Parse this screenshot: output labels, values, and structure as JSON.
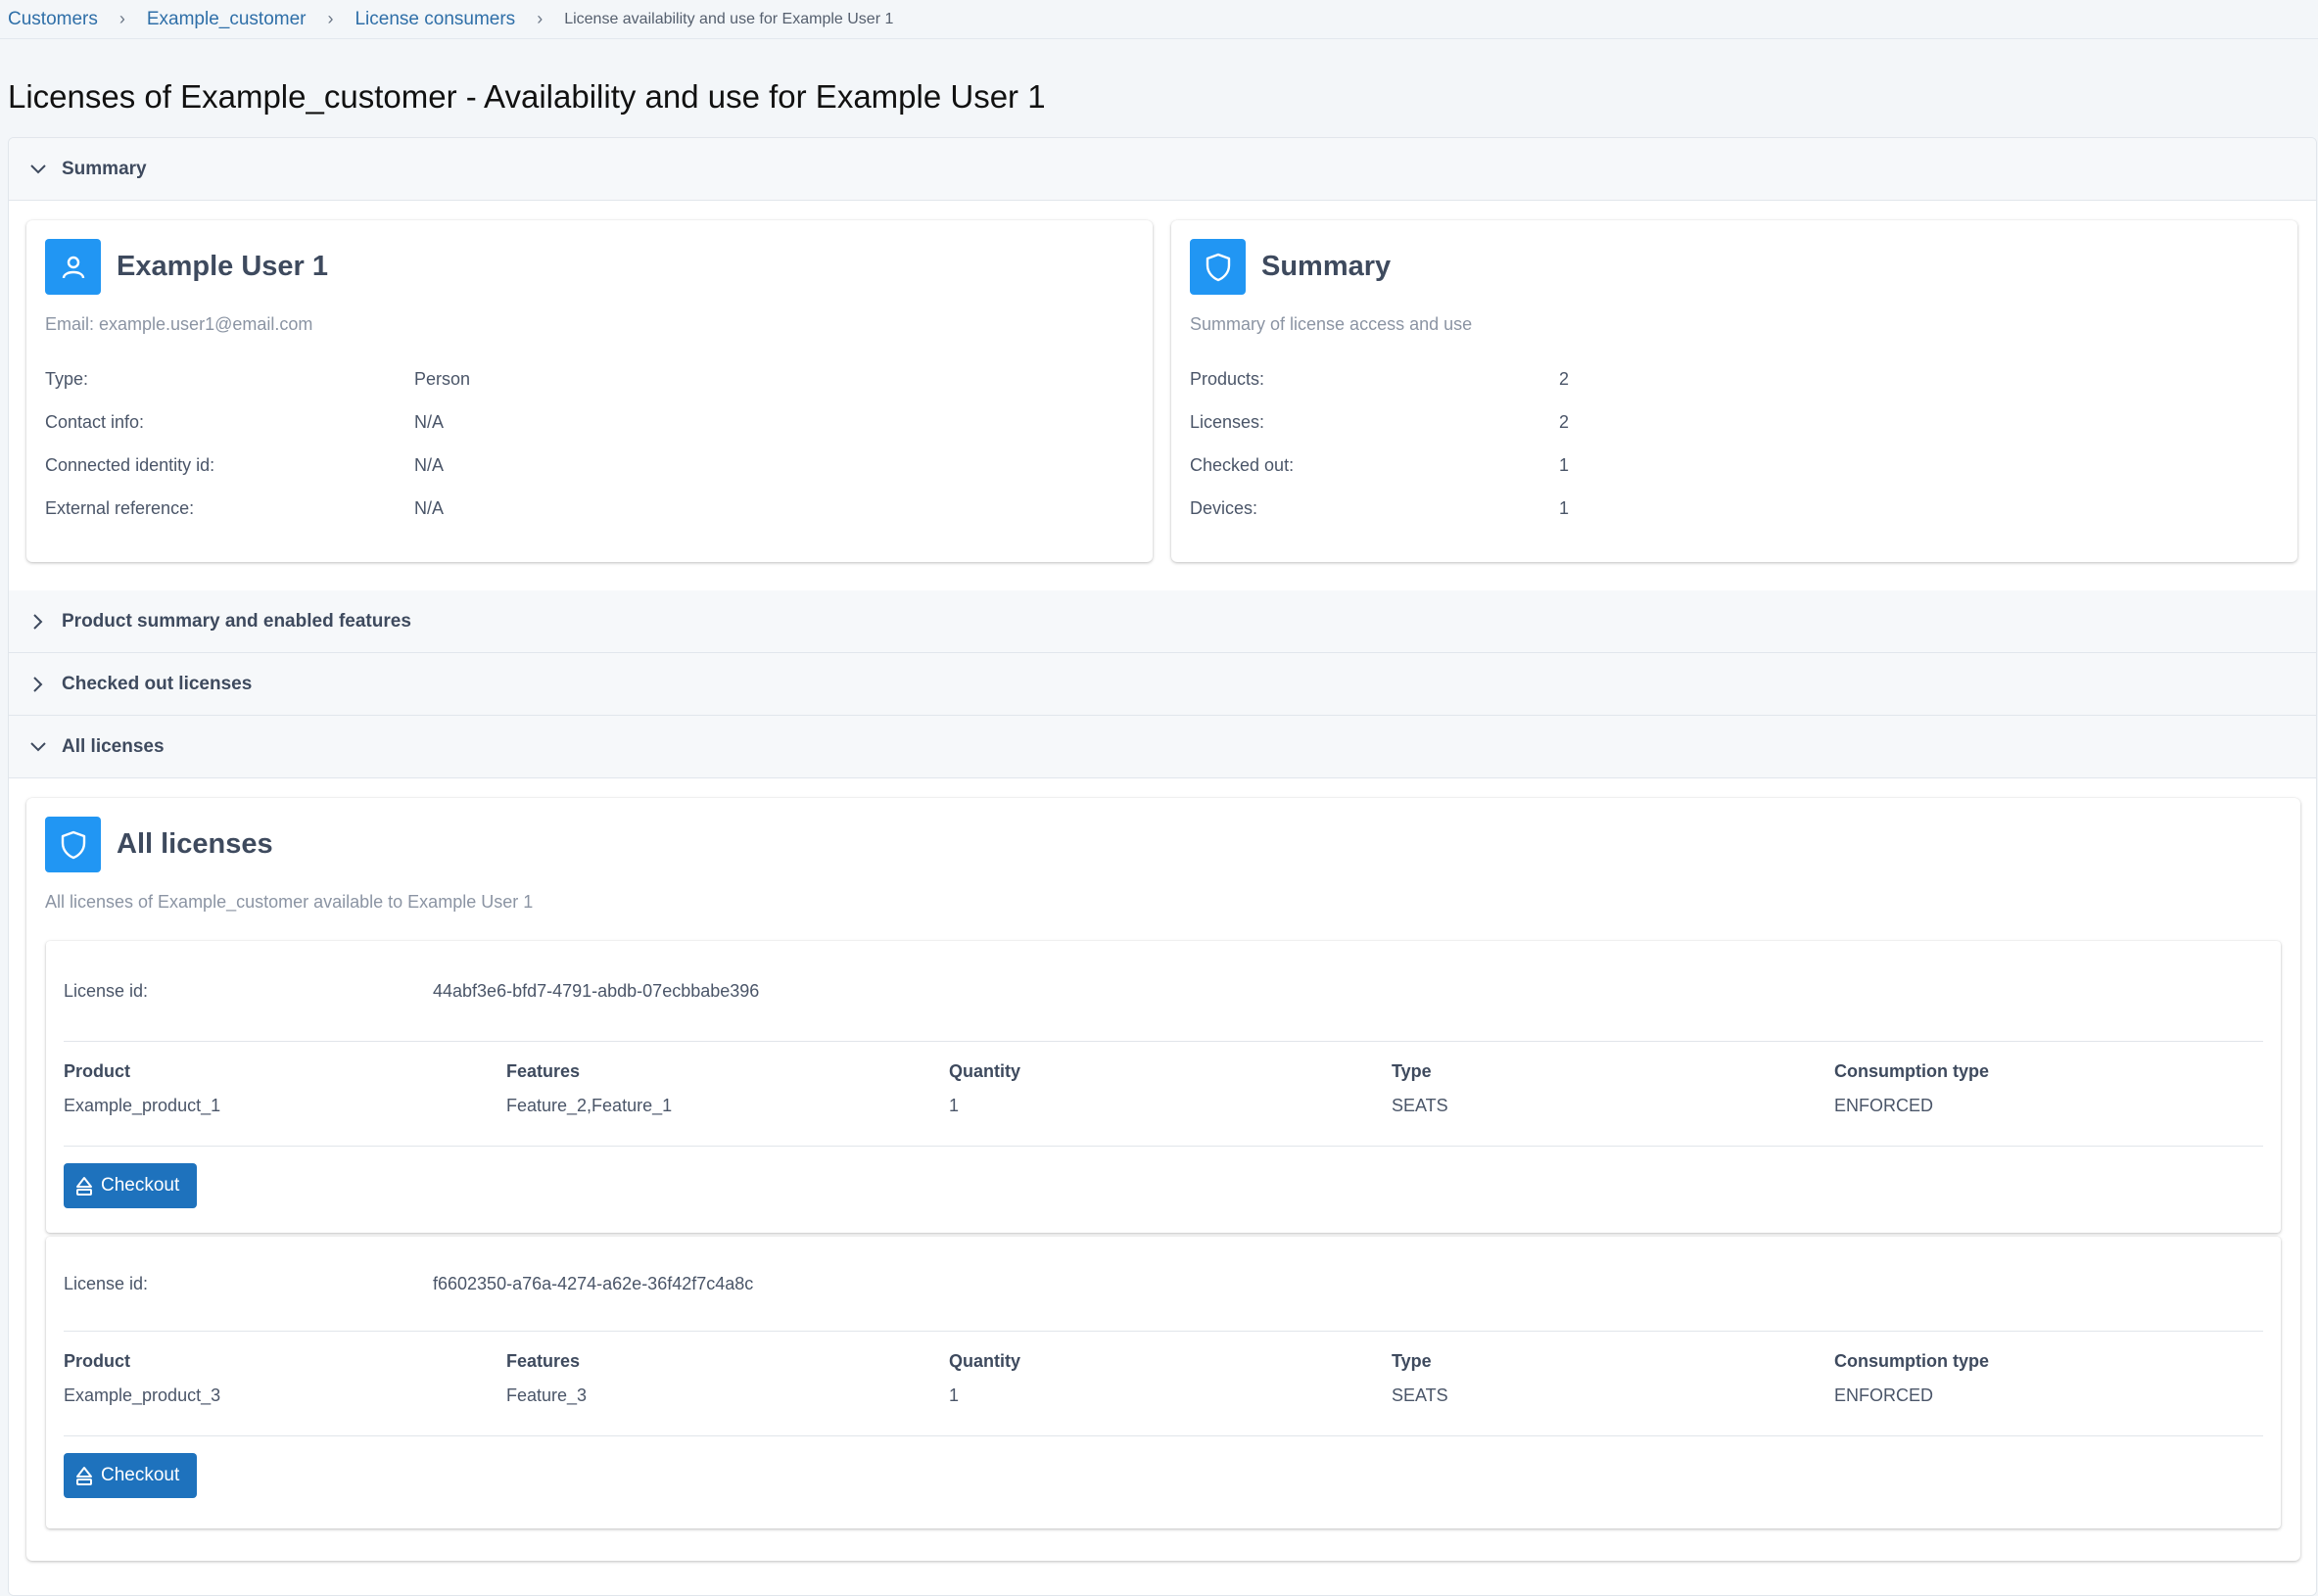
{
  "breadcrumb": {
    "items": [
      "Customers",
      "Example_customer",
      "License consumers"
    ],
    "current": "License availability and use for Example User 1"
  },
  "page_title": "Licenses of Example_customer - Availability and use for Example User 1",
  "sections": {
    "summary": {
      "label": "Summary",
      "expanded": true
    },
    "product_summary": {
      "label": "Product summary and enabled features",
      "expanded": false
    },
    "checked_out": {
      "label": "Checked out licenses",
      "expanded": false
    },
    "all_licenses": {
      "label": "All licenses",
      "expanded": true
    }
  },
  "user_card": {
    "icon": "user-icon",
    "title": "Example User 1",
    "subtitle": "Email: example.user1@email.com",
    "fields": [
      {
        "label": "Type:",
        "value": "Person"
      },
      {
        "label": "Contact info:",
        "value": "N/A"
      },
      {
        "label": "Connected identity id:",
        "value": "N/A"
      },
      {
        "label": "External reference:",
        "value": "N/A"
      }
    ]
  },
  "summary_card": {
    "icon": "shield-icon",
    "title": "Summary",
    "subtitle": "Summary of license access and use",
    "fields": [
      {
        "label": "Products:",
        "value": "2"
      },
      {
        "label": "Licenses:",
        "value": "2"
      },
      {
        "label": "Checked out:",
        "value": "1"
      },
      {
        "label": "Devices:",
        "value": "1"
      }
    ]
  },
  "all_licenses_card": {
    "icon": "shield-icon",
    "title": "All licenses",
    "subtitle": "All licenses of Example_customer available to Example User 1",
    "license_id_label": "License id:",
    "columns": [
      "Product",
      "Features",
      "Quantity",
      "Type",
      "Consumption type"
    ],
    "checkout_label": "Checkout",
    "licenses": [
      {
        "id": "44abf3e6-bfd7-4791-abdb-07ecbbabe396",
        "product": "Example_product_1",
        "features": "Feature_2,Feature_1",
        "quantity": "1",
        "type": "SEATS",
        "consumption_type": "ENFORCED"
      },
      {
        "id": "f6602350-a76a-4274-a62e-36f42f7c4a8c",
        "product": "Example_product_3",
        "features": "Feature_3",
        "quantity": "1",
        "type": "SEATS",
        "consumption_type": "ENFORCED"
      }
    ]
  },
  "colors": {
    "accent_icon": "#2196f3",
    "button": "#1e72bd",
    "link": "#2f6fa8"
  }
}
